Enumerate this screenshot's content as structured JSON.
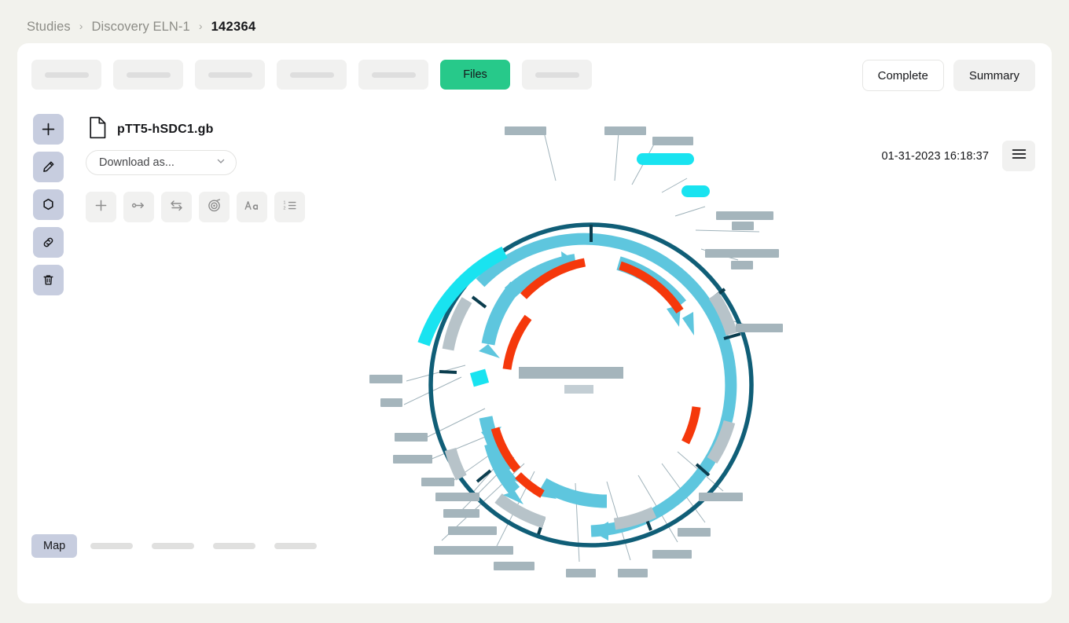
{
  "breadcrumb": {
    "items": [
      {
        "label": "Studies",
        "current": false
      },
      {
        "label": "Discovery ELN-1",
        "current": false
      },
      {
        "label": "142364",
        "current": true
      }
    ],
    "separator": "›"
  },
  "tabs": {
    "items": [
      {
        "label": "",
        "redacted": true,
        "active": false
      },
      {
        "label": "",
        "redacted": true,
        "active": false
      },
      {
        "label": "",
        "redacted": true,
        "active": false
      },
      {
        "label": "",
        "redacted": true,
        "active": false
      },
      {
        "label": "",
        "redacted": true,
        "active": false
      },
      {
        "label": "Files",
        "redacted": false,
        "active": true
      },
      {
        "label": "",
        "redacted": true,
        "active": false
      }
    ],
    "active_color": "#27c98a"
  },
  "header_actions": {
    "complete_label": "Complete",
    "summary_label": "Summary"
  },
  "rail": {
    "items": [
      {
        "name": "add-icon",
        "label": "Add"
      },
      {
        "name": "edit-pencil-icon",
        "label": "Edit"
      },
      {
        "name": "hexagon-icon",
        "label": "Shape"
      },
      {
        "name": "link-icon",
        "label": "Link"
      },
      {
        "name": "trash-icon",
        "label": "Delete"
      }
    ],
    "button_color": "#c7cddf"
  },
  "file": {
    "icon": "file-icon",
    "name": "pTT5-hSDC1.gb",
    "timestamp": "01-31-2023 16:18:37"
  },
  "download_select": {
    "value": "Download as...",
    "caret": "chevron-down-icon"
  },
  "map_toolbar": {
    "items": [
      {
        "name": "plus-icon"
      },
      {
        "name": "arrow-right-endpoint-icon"
      },
      {
        "name": "swap-arrows-icon"
      },
      {
        "name": "circular-map-icon"
      },
      {
        "name": "text-format-icon"
      },
      {
        "name": "numbered-list-icon"
      }
    ]
  },
  "menu_button": {
    "name": "hamburger-icon"
  },
  "bottom_tabs": {
    "items": [
      {
        "label": "Map",
        "redacted": false,
        "active": true
      },
      {
        "label": "",
        "redacted": true,
        "active": false
      },
      {
        "label": "",
        "redacted": true,
        "active": false
      },
      {
        "label": "",
        "redacted": true,
        "active": false
      },
      {
        "label": "",
        "redacted": true,
        "active": false
      }
    ]
  },
  "plasmid_map": {
    "title": "pTT5-hSDC1.gb circular plasmid map",
    "colors": {
      "backbone": "#105e77",
      "feature_light_blue": "#5ec6de",
      "feature_cyan": "#19e3f0",
      "feature_red": "#f5380b",
      "label_grey": "#a5b5bc",
      "label_grey_light": "#c3ced4",
      "leader_line": "#9fb2ba"
    }
  }
}
